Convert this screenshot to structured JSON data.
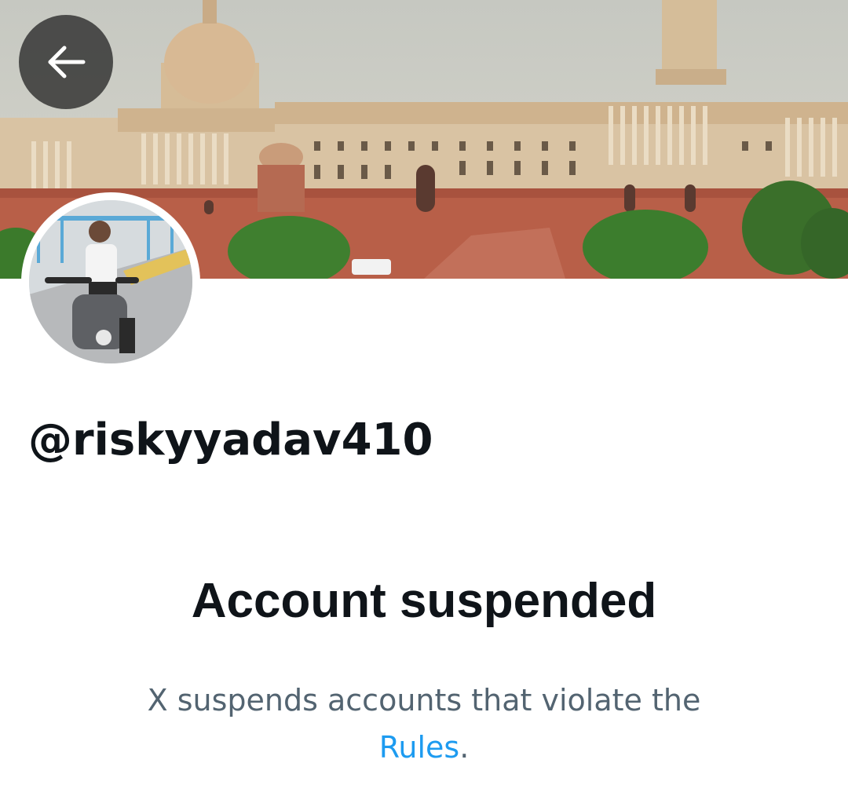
{
  "profile": {
    "handle": "@riskyyadav410"
  },
  "suspension": {
    "title": "Account suspended",
    "description_prefix": "X suspends accounts that violate the",
    "rules_link_text": "Rules",
    "description_suffix": "."
  },
  "icons": {
    "back": "arrow-left-icon"
  },
  "colors": {
    "text_primary": "#0f1419",
    "text_secondary": "#536471",
    "link": "#1d9bf0",
    "back_button_bg": "#282828"
  }
}
